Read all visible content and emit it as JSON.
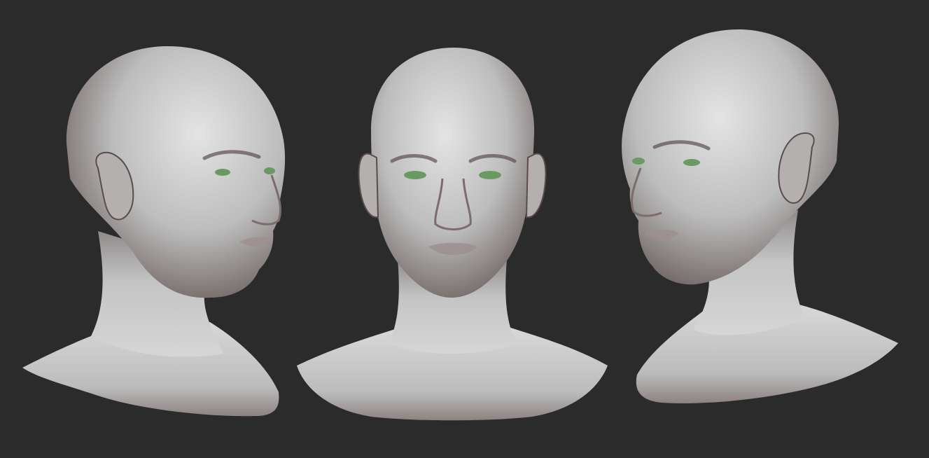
{
  "scene": {
    "background": "#2b2b2b",
    "skin_light": "#d8d8d8",
    "skin_mid": "#a9a9a9",
    "skin_dark": "#4a3a38",
    "eye_color": "#6a9a62",
    "lip_color": "#9c8f8f",
    "views": [
      {
        "id": "three-quarter-right",
        "facing": "right"
      },
      {
        "id": "front",
        "facing": "front"
      },
      {
        "id": "three-quarter-left",
        "facing": "left"
      }
    ]
  }
}
